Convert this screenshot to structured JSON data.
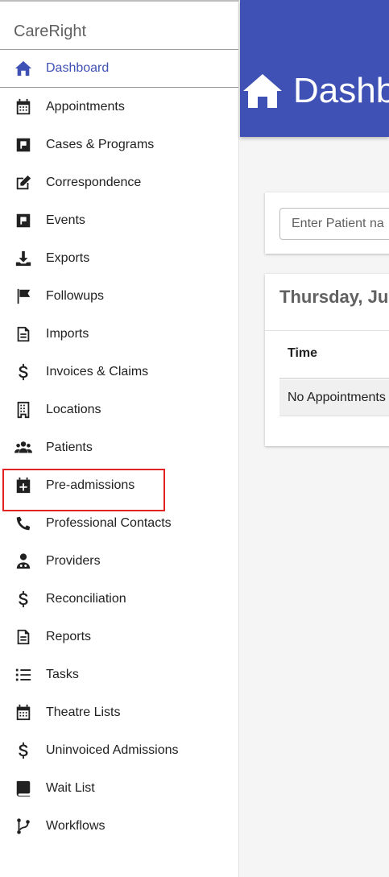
{
  "sidebar": {
    "brand": "CareRight",
    "items": [
      {
        "label": "Dashboard",
        "icon": "home-icon",
        "active": true
      },
      {
        "label": "Appointments",
        "icon": "calendar-icon"
      },
      {
        "label": "Cases & Programs",
        "icon": "flag-square-icon"
      },
      {
        "label": "Correspondence",
        "icon": "edit-icon"
      },
      {
        "label": "Events",
        "icon": "flag-square-icon"
      },
      {
        "label": "Exports",
        "icon": "download-icon"
      },
      {
        "label": "Followups",
        "icon": "flag-icon"
      },
      {
        "label": "Imports",
        "icon": "document-icon"
      },
      {
        "label": "Invoices & Claims",
        "icon": "dollar-icon"
      },
      {
        "label": "Locations",
        "icon": "building-icon"
      },
      {
        "label": "Patients",
        "icon": "users-icon"
      },
      {
        "label": "Pre-admissions",
        "icon": "calendar-plus-icon",
        "highlighted": true
      },
      {
        "label": "Professional Contacts",
        "icon": "phone-icon"
      },
      {
        "label": "Providers",
        "icon": "doctor-icon"
      },
      {
        "label": "Reconciliation",
        "icon": "dollar-icon"
      },
      {
        "label": "Reports",
        "icon": "document-icon"
      },
      {
        "label": "Tasks",
        "icon": "list-icon"
      },
      {
        "label": "Theatre Lists",
        "icon": "calendar-icon"
      },
      {
        "label": "Uninvoiced Admissions",
        "icon": "dollar-icon"
      },
      {
        "label": "Wait List",
        "icon": "book-icon"
      },
      {
        "label": "Workflows",
        "icon": "branch-icon"
      }
    ]
  },
  "header": {
    "title": "Dashb",
    "icon": "home-icon"
  },
  "search": {
    "placeholder": "Enter Patient na"
  },
  "appointments": {
    "date": "Thursday, Ju",
    "column_time": "Time",
    "empty_text": "No Appointments"
  },
  "colors": {
    "accent": "#3f51b5",
    "highlight": "#e02424"
  }
}
